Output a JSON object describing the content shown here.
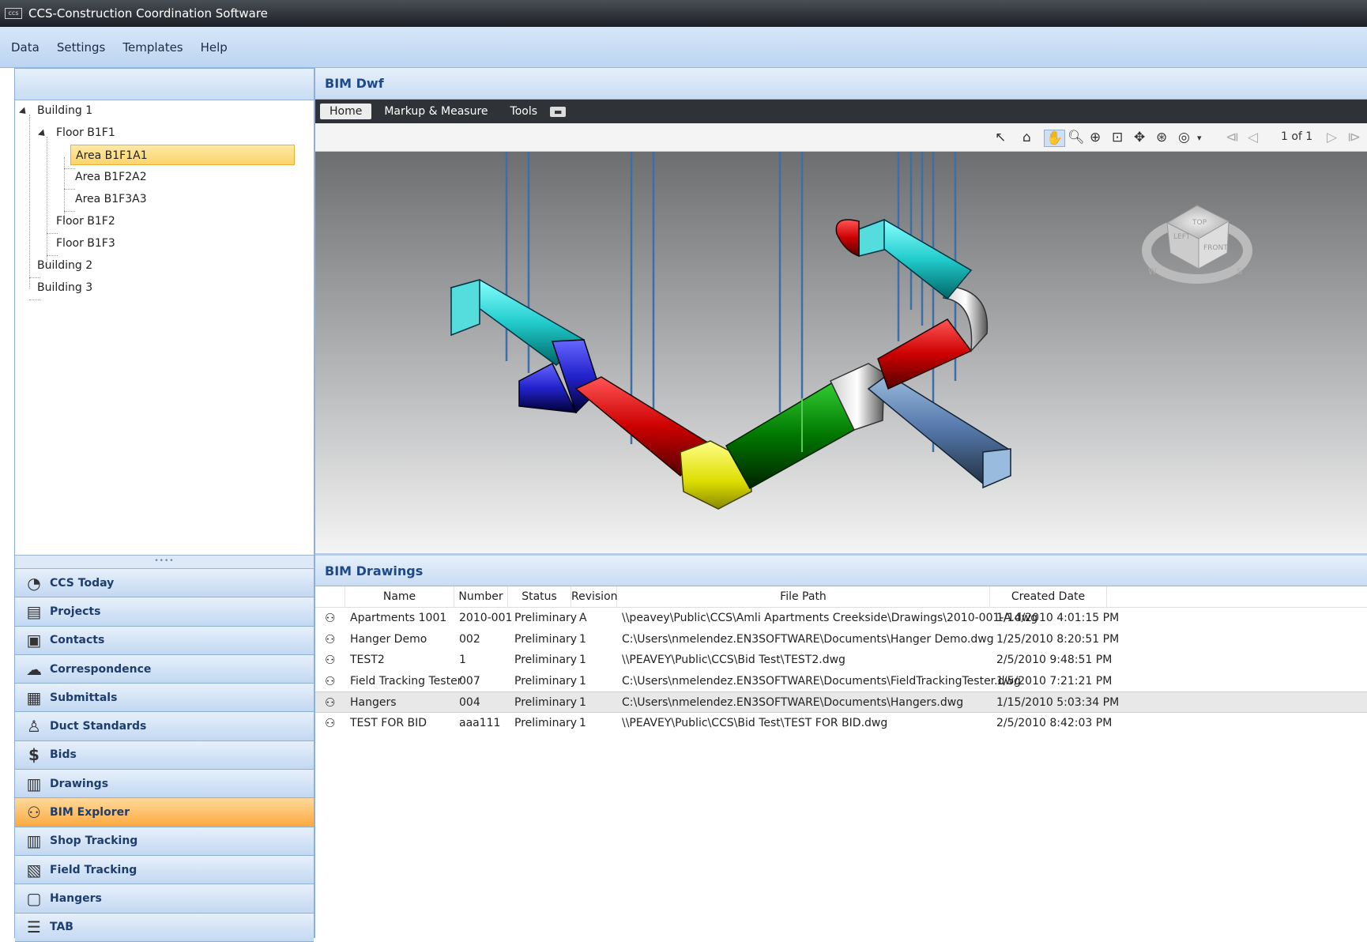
{
  "window": {
    "title": "CCS-Construction Coordination Software",
    "app_icon": "ccs"
  },
  "menu": [
    "Data",
    "Settings",
    "Templates",
    "Help"
  ],
  "tree": {
    "nodes": [
      {
        "label": "Building 1"
      },
      {
        "label": "Floor B1F1"
      },
      {
        "label": "Area B1F1A1"
      },
      {
        "label": "Area B1F2A2"
      },
      {
        "label": "Area B1F3A3"
      },
      {
        "label": "Floor B1F2"
      },
      {
        "label": "Floor B1F3"
      },
      {
        "label": "Building 2"
      },
      {
        "label": "Building 3"
      }
    ],
    "selected": "Area B1F1A1"
  },
  "nav": [
    {
      "label": "CCS Today",
      "icon": "clock-icon"
    },
    {
      "label": "Projects",
      "icon": "projects-icon"
    },
    {
      "label": "Contacts",
      "icon": "contacts-icon"
    },
    {
      "label": "Correspondence",
      "icon": "correspondence-icon"
    },
    {
      "label": "Submittals",
      "icon": "submittals-icon"
    },
    {
      "label": "Duct Standards",
      "icon": "duct-standards-icon"
    },
    {
      "label": "Bids",
      "icon": "dollar-icon"
    },
    {
      "label": "Drawings",
      "icon": "drawings-icon"
    },
    {
      "label": "BIM Explorer",
      "icon": "binoculars-icon"
    },
    {
      "label": "Shop Tracking",
      "icon": "shop-tracking-icon"
    },
    {
      "label": "Field Tracking",
      "icon": "field-tracking-icon"
    },
    {
      "label": "Hangers",
      "icon": "hangers-icon"
    },
    {
      "label": "TAB",
      "icon": "tab-icon"
    }
  ],
  "nav_active": "BIM Explorer",
  "viewer": {
    "title": "BIM Dwf",
    "tabs": [
      "Home",
      "Markup & Measure",
      "Tools"
    ],
    "active_tab": "Home",
    "page_indicator": "1 of 1",
    "viewcube": {
      "top": "TOP",
      "left": "LEFT",
      "front": "FRONT",
      "w": "W",
      "s": "S"
    }
  },
  "drawings": {
    "title": "BIM Drawings",
    "columns": [
      "Name",
      "Number",
      "Status",
      "Revision",
      "File Path",
      "Created Date"
    ],
    "rows": [
      {
        "name": "Apartments 1001",
        "number": "2010-001",
        "status": "Preliminary",
        "revision": "A",
        "path": "\\\\peavey\\Public\\CCS\\Amli Apartments Creekside\\Drawings\\2010-001-A.dwg",
        "created": "1/14/2010 4:01:15 PM"
      },
      {
        "name": "Hanger Demo",
        "number": "002",
        "status": "Preliminary",
        "revision": "1",
        "path": "C:\\Users\\nmelendez.EN3SOFTWARE\\Documents\\Hanger Demo.dwg",
        "created": "1/25/2010 8:20:51 PM"
      },
      {
        "name": "TEST2",
        "number": "1",
        "status": "Preliminary",
        "revision": "1",
        "path": "\\\\PEAVEY\\Public\\CCS\\Bid Test\\TEST2.dwg",
        "created": "2/5/2010 9:48:51 PM"
      },
      {
        "name": "Field Tracking Tester",
        "number": "007",
        "status": "Preliminary",
        "revision": "1",
        "path": "C:\\Users\\nmelendez.EN3SOFTWARE\\Documents\\FieldTrackingTester.dwg",
        "created": "1/5/2010 7:21:21 PM"
      },
      {
        "name": "Hangers",
        "number": "004",
        "status": "Preliminary",
        "revision": "1",
        "path": "C:\\Users\\nmelendez.EN3SOFTWARE\\Documents\\Hangers.dwg",
        "created": "1/15/2010 5:03:34 PM"
      },
      {
        "name": "TEST FOR BID",
        "number": "aaa111",
        "status": "Preliminary",
        "revision": "1",
        "path": "\\\\PEAVEY\\Public\\CCS\\Bid Test\\TEST FOR BID.dwg",
        "created": "2/5/2010 8:42:03 PM"
      }
    ],
    "highlighted_row": "Hangers"
  },
  "colors": {
    "accent": "#1e4a8a",
    "active_nav": "#fba93f",
    "selection": "#fbd46b"
  }
}
